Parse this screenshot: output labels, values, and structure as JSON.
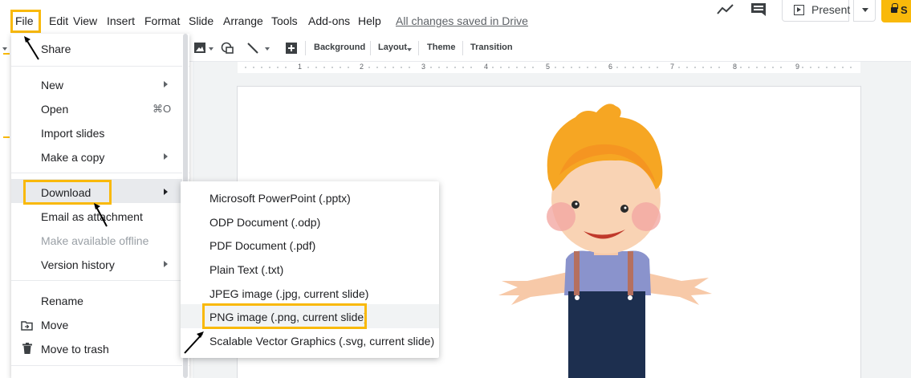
{
  "menubar": {
    "items": [
      "File",
      "Edit",
      "View",
      "Insert",
      "Format",
      "Slide",
      "Arrange",
      "Tools",
      "Add-ons",
      "Help"
    ],
    "saved_status": "All changes saved in Drive",
    "present_label": "Present",
    "share_label": "S"
  },
  "toolbar": {
    "background": "Background",
    "layout": "Layout",
    "theme": "Theme",
    "transition": "Transition"
  },
  "ruler": {
    "numbers": [
      "1",
      "2",
      "3",
      "4",
      "5",
      "6",
      "7",
      "8",
      "9"
    ]
  },
  "file_menu": {
    "share": "Share",
    "new": "New",
    "open": "Open",
    "open_shortcut": "⌘O",
    "import_slides": "Import slides",
    "make_copy": "Make a copy",
    "download": "Download",
    "email_attachment": "Email as attachment",
    "make_offline": "Make available offline",
    "version_history": "Version history",
    "rename": "Rename",
    "move": "Move",
    "move_trash": "Move to trash"
  },
  "download_submenu": {
    "items": [
      "Microsoft PowerPoint (.pptx)",
      "ODP Document (.odp)",
      "PDF Document (.pdf)",
      "Plain Text (.txt)",
      "JPEG image (.jpg, current slide)",
      "PNG image (.png, current slide)",
      "Scalable Vector Graphics (.svg, current slide)"
    ]
  },
  "colors": {
    "highlight_box": "#f9b90a",
    "menu_hover": "#e8eaed"
  }
}
